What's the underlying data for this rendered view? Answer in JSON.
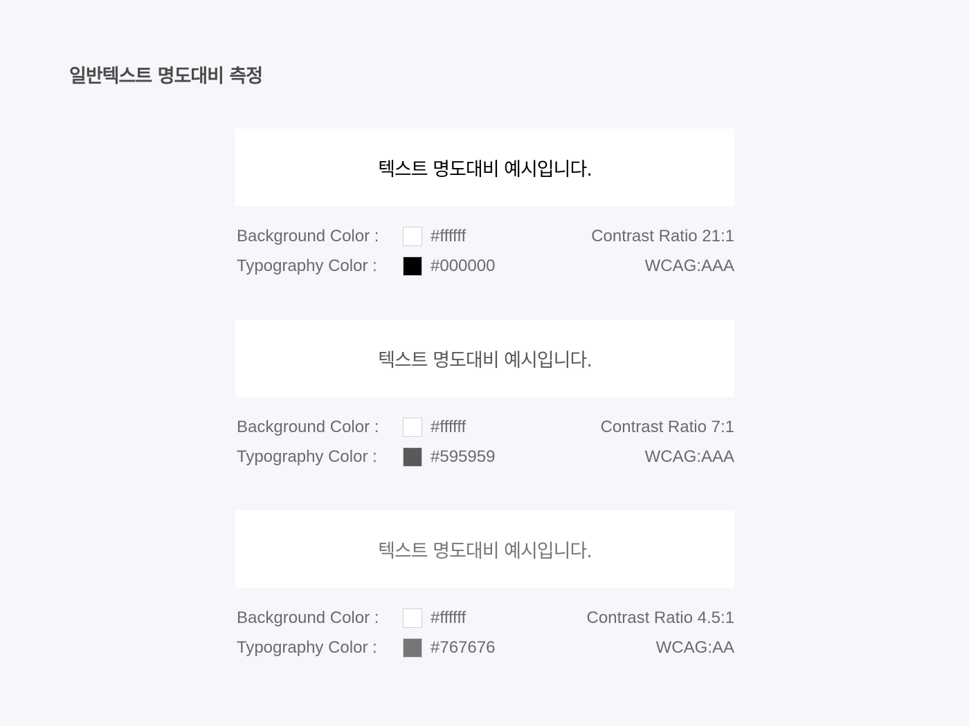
{
  "page_title": "일반텍스트 명도대비 측정",
  "samples": [
    {
      "preview_text": "텍스트 명도대비 예시입니다.",
      "background_label": "Background Color :",
      "background_hex": "#ffffff",
      "background_color": "#ffffff",
      "typography_label": "Typography Color :",
      "typography_hex": "#000000",
      "typography_color": "#000000",
      "contrast_ratio": "Contrast Ratio 21:1",
      "wcag": "WCAG:AAA"
    },
    {
      "preview_text": "텍스트 명도대비 예시입니다.",
      "background_label": "Background Color :",
      "background_hex": "#ffffff",
      "background_color": "#ffffff",
      "typography_label": "Typography Color :",
      "typography_hex": "#595959",
      "typography_color": "#595959",
      "contrast_ratio": "Contrast Ratio 7:1",
      "wcag": "WCAG:AAA"
    },
    {
      "preview_text": "텍스트 명도대비 예시입니다.",
      "background_label": "Background Color :",
      "background_hex": "#ffffff",
      "background_color": "#ffffff",
      "typography_label": "Typography Color :",
      "typography_hex": "#767676",
      "typography_color": "#767676",
      "contrast_ratio": "Contrast Ratio 4.5:1",
      "wcag": "WCAG:AA"
    }
  ]
}
